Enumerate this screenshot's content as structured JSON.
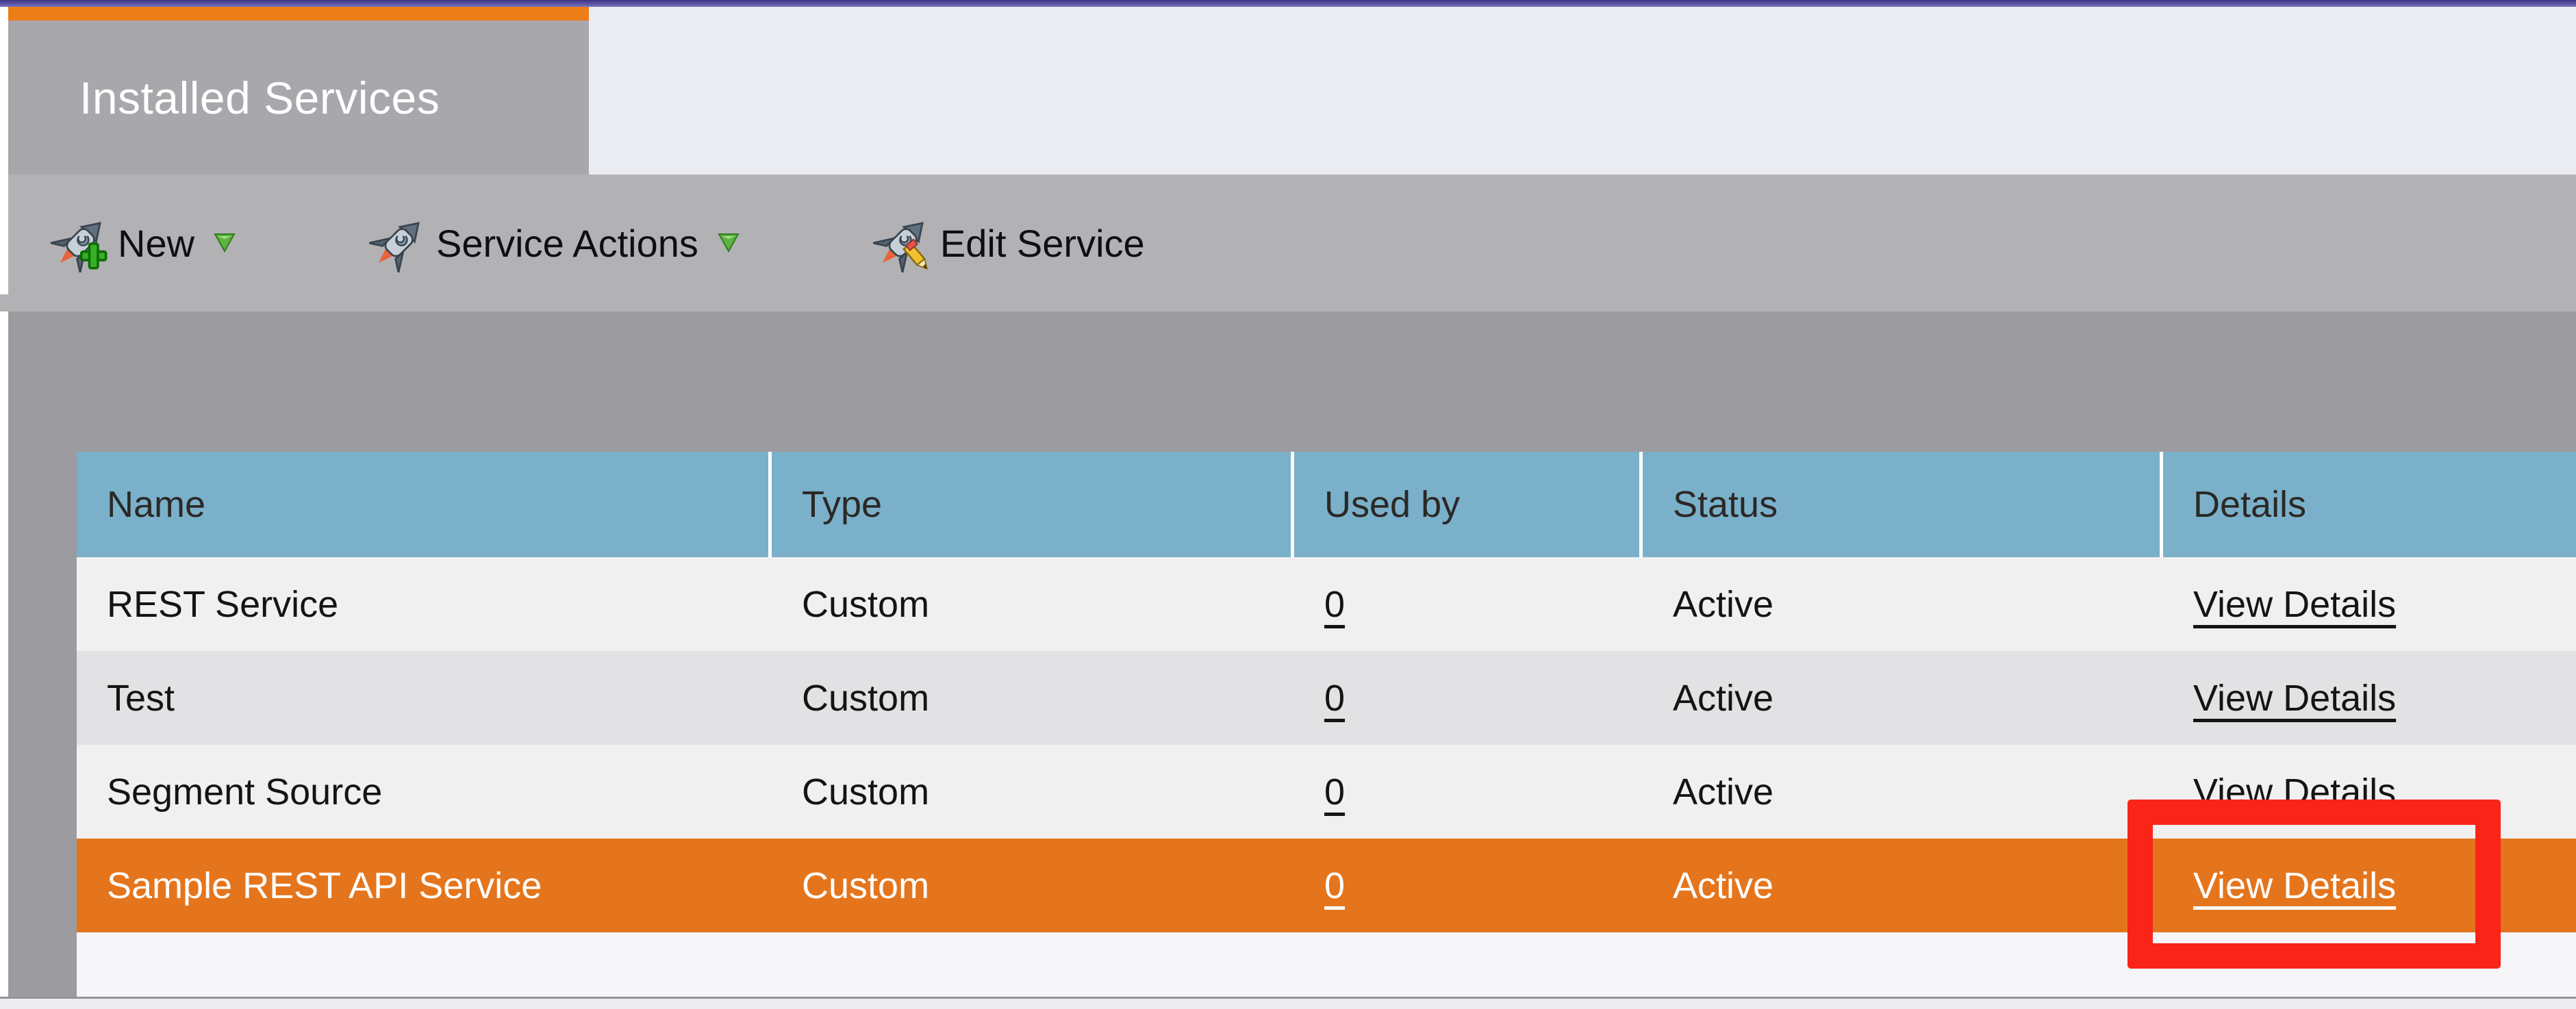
{
  "tab": {
    "title": "Installed Services"
  },
  "toolbar": {
    "buttons": [
      {
        "label": "New",
        "icon": "rocket-plus-icon",
        "dropdown": true
      },
      {
        "label": "Service Actions",
        "icon": "rocket-icon",
        "dropdown": true
      },
      {
        "label": "Edit Service",
        "icon": "rocket-pencil-icon",
        "dropdown": false
      }
    ]
  },
  "table": {
    "columns": [
      "Name",
      "Type",
      "Used by",
      "Status",
      "Details"
    ],
    "rows": [
      {
        "name": "REST Service",
        "type": "Custom",
        "used_by": "0",
        "status": "Active",
        "details_link": "View Details",
        "selected": false
      },
      {
        "name": "Test",
        "type": "Custom",
        "used_by": "0",
        "status": "Active",
        "details_link": "View Details",
        "selected": false
      },
      {
        "name": "Segment Source",
        "type": "Custom",
        "used_by": "0",
        "status": "Active",
        "details_link": "View Details",
        "selected": false
      },
      {
        "name": "Sample REST API Service",
        "type": "Custom",
        "used_by": "0",
        "status": "Active",
        "details_link": "View Details",
        "selected": true
      }
    ]
  },
  "annotation": {
    "shape": "rectangle",
    "color": "#fa2418"
  },
  "colors": {
    "top_bar_purple": "#5a53a6",
    "accent_orange": "#ed7d17",
    "selected_row_orange": "#e5751c",
    "header_blue": "#7ab0ca",
    "tab_gray": "#a8a7ab",
    "toolbar_gray": "#b2b1b4",
    "content_gray": "#9c9b9f",
    "annotation_red": "#fa2418"
  }
}
